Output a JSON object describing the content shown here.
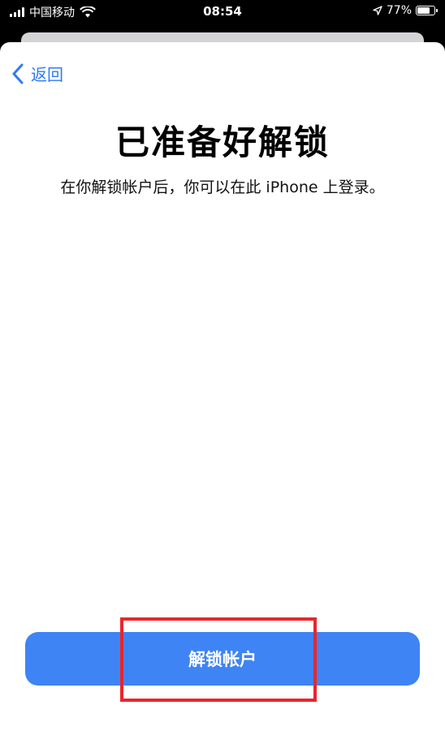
{
  "status_bar": {
    "carrier": "中国移动",
    "time": "08:54",
    "battery_percent": "77%",
    "battery_level": 0.77,
    "icons": [
      "signal-icon",
      "wifi-icon",
      "location-arrow-icon",
      "battery-icon"
    ]
  },
  "nav": {
    "back_label": "返回",
    "back_icon": "chevron-left-icon"
  },
  "main": {
    "title": "已准备好解锁",
    "subtitle": "在你解锁帐户后，你可以在此 iPhone 上登录。"
  },
  "actions": {
    "unlock_label": "解锁帐户"
  },
  "colors": {
    "accent": "#2f7af4",
    "button": "#3f84f4",
    "highlight": "#e8262d",
    "background": "#ffffff"
  }
}
